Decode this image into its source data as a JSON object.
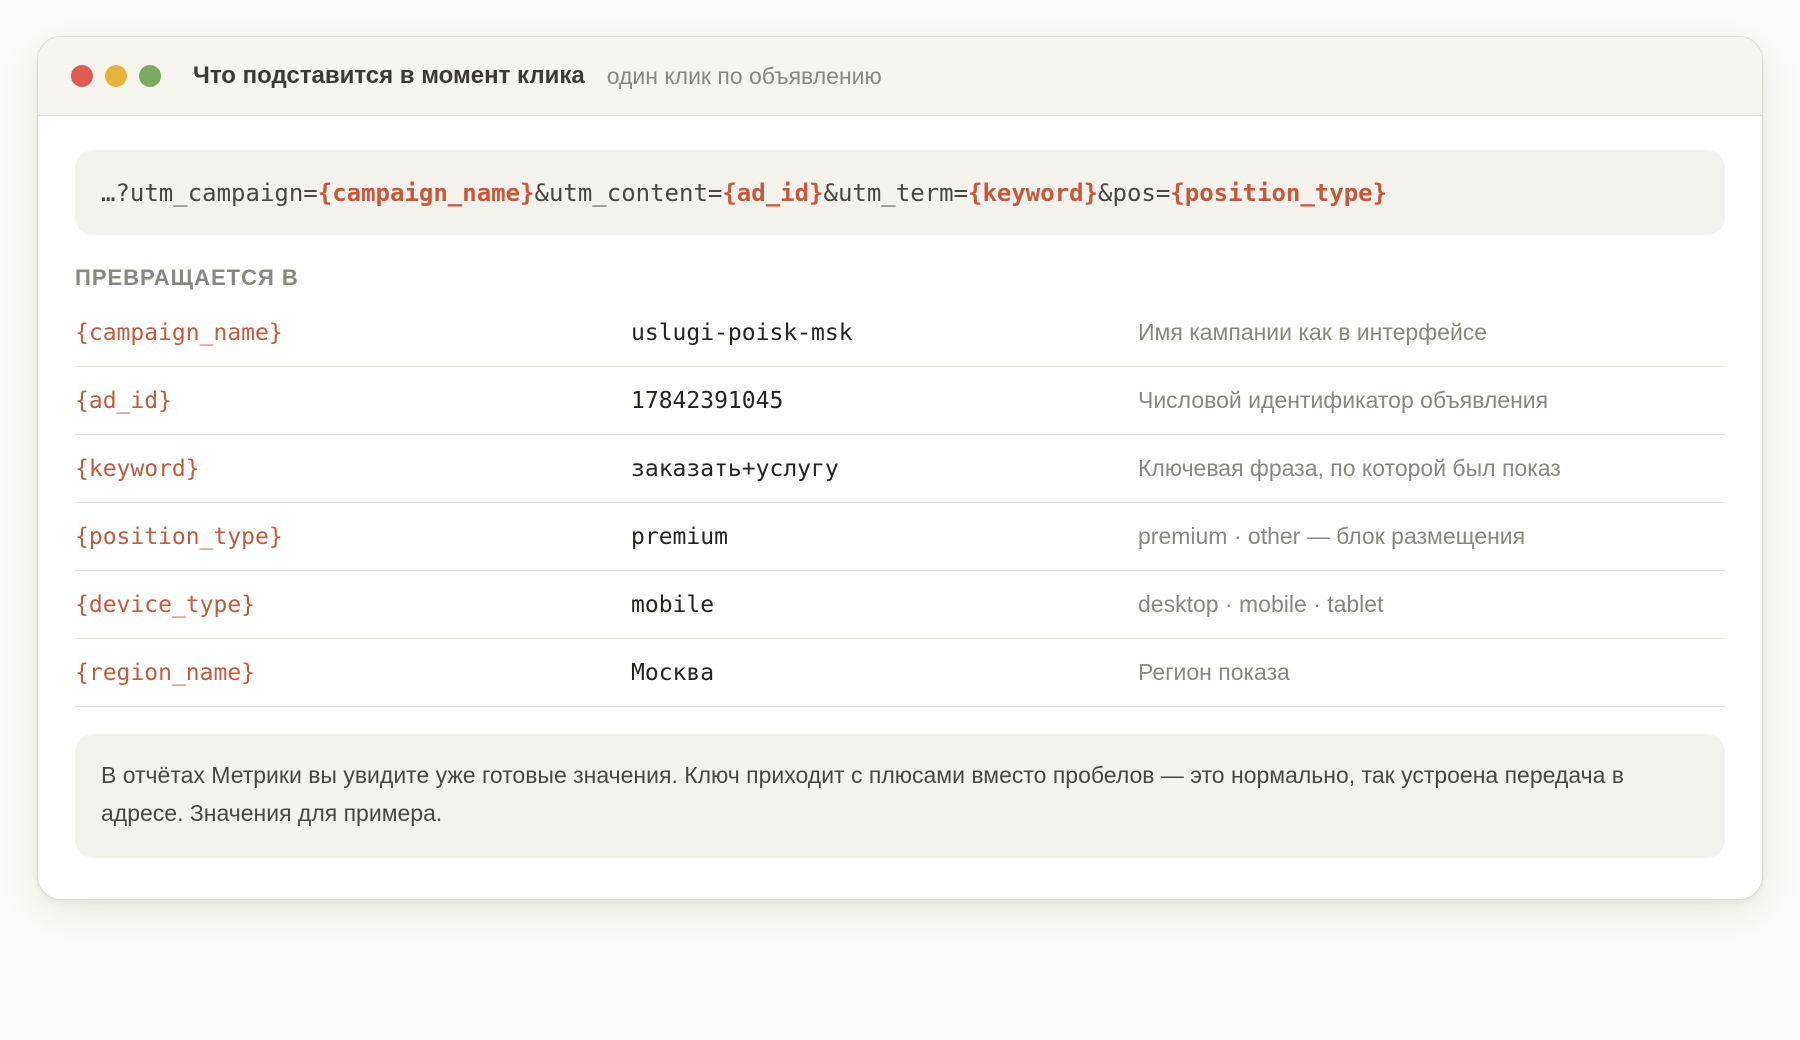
{
  "window": {
    "title": "Что подставится в момент клика",
    "subtitle": "один клик по объявлению",
    "controls": [
      "close",
      "minimize",
      "maximize"
    ]
  },
  "url_template": {
    "segments": [
      {
        "text": "…?utm_campaign=",
        "placeholder": false
      },
      {
        "text": "{campaign_name}",
        "placeholder": true
      },
      {
        "text": "&utm_content=",
        "placeholder": false
      },
      {
        "text": "{ad_id}",
        "placeholder": true
      },
      {
        "text": "&utm_term=",
        "placeholder": false
      },
      {
        "text": "{keyword}",
        "placeholder": true
      },
      {
        "text": "&pos=",
        "placeholder": false
      },
      {
        "text": "{position_type}",
        "placeholder": true
      }
    ]
  },
  "section_label": "ПРЕВРАЩАЕТСЯ В",
  "rows": [
    {
      "key": "{campaign_name}",
      "value": "uslugi-poisk-msk",
      "description": "Имя кампании как в интерфейсе"
    },
    {
      "key": "{ad_id}",
      "value": "17842391045",
      "description": "Числовой идентификатор объявления"
    },
    {
      "key": "{keyword}",
      "value": "заказать+услугу",
      "description": "Ключевая фраза, по которой был показ"
    },
    {
      "key": "{position_type}",
      "value": "premium",
      "description": "premium · other — блок размещения"
    },
    {
      "key": "{device_type}",
      "value": "mobile",
      "description": "desktop · mobile · tablet"
    },
    {
      "key": "{region_name}",
      "value": "Москва",
      "description": "Регион показа"
    }
  ],
  "note": "В отчётах Метрики вы увидите уже готовые значения. Ключ приходит с плюсами вместо пробелов — это нормально, так устроена передача в адресе. Значения для примера.",
  "colors": {
    "placeholder": "#c9573a",
    "close": "#dc5b53",
    "minimize": "#e6b43d",
    "maximize": "#79aa62"
  }
}
